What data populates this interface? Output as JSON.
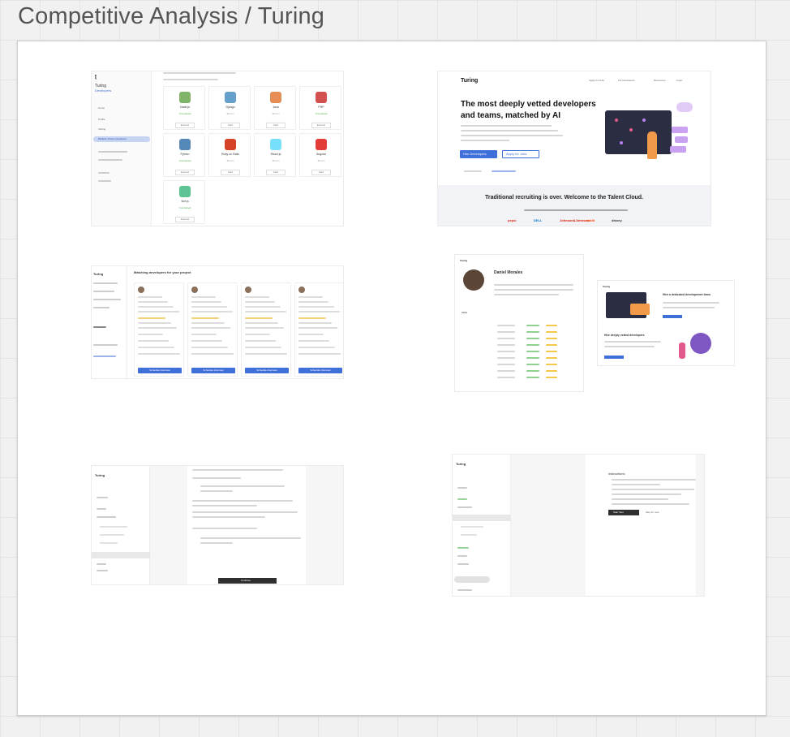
{
  "board": {
    "title": "Competitive Analysis / Turing"
  },
  "shot1": {
    "brand": "Turing",
    "brand_sub": "Developers",
    "nav": [
      "Home",
      "Profile",
      "Vetting",
      "Multiple Choice Questions"
    ],
    "skills": [
      {
        "name": "Node.js",
        "status": "Completed",
        "action": "Expand",
        "color": "#6aa84f"
      },
      {
        "name": "Django",
        "status": "30 min",
        "action": "Start",
        "color": "#4b91c3"
      },
      {
        "name": "Java",
        "status": "30 min",
        "action": "Start",
        "color": "#e07b39"
      },
      {
        "name": "PHP",
        "status": "Completed",
        "action": "Expand",
        "color": "#cc3333"
      },
      {
        "name": "Python",
        "status": "Completed",
        "action": "Expand",
        "color": "#3776ab"
      },
      {
        "name": "Ruby on Rails",
        "status": "30 min",
        "action": "Start",
        "color": "#cc2200"
      },
      {
        "name": "React.js",
        "status": "30 min",
        "action": "Start",
        "color": "#61dafb"
      },
      {
        "name": "Angular",
        "status": "30 min",
        "action": "Start",
        "color": "#dd1b16"
      },
      {
        "name": "Vue.js",
        "status": "Completed",
        "action": "Expand",
        "color": "#41b883"
      }
    ]
  },
  "shot2": {
    "brand": "Turing",
    "nav": [
      "Apply for Jobs",
      "For Developers",
      "Resources",
      "Login"
    ],
    "headline": "The most deeply vetted developers and teams, matched by AI",
    "btn_primary": "Hire Developers",
    "btn_secondary": "Apply for Jobs",
    "banner": "Traditional recruiting is over. Welcome to the Talent Cloud.",
    "logos": [
      "pepsi",
      "DELL",
      "Johnson&Johnson",
      "reddit",
      "disney"
    ]
  },
  "shot3": {
    "brand": "Turing",
    "heading": "Matching developers for your project",
    "cards": [
      "Developer 1",
      "Developer 2",
      "Developer 3",
      "Developer 4"
    ],
    "cta": "Schedule Interview"
  },
  "shot4": {
    "brand": "Turing",
    "name": "Daniel Morales",
    "skills_label": "Skills",
    "inner_headline": "Hire a dedicated development team",
    "inner_sub": "Hire deeply vetted developers"
  },
  "shot5": {
    "brand": "Turing",
    "button": "Continue"
  },
  "shot6": {
    "brand": "Turing",
    "heading": "Instructions",
    "btn_start": "Start Test",
    "btn_skip": "Skip for now"
  }
}
